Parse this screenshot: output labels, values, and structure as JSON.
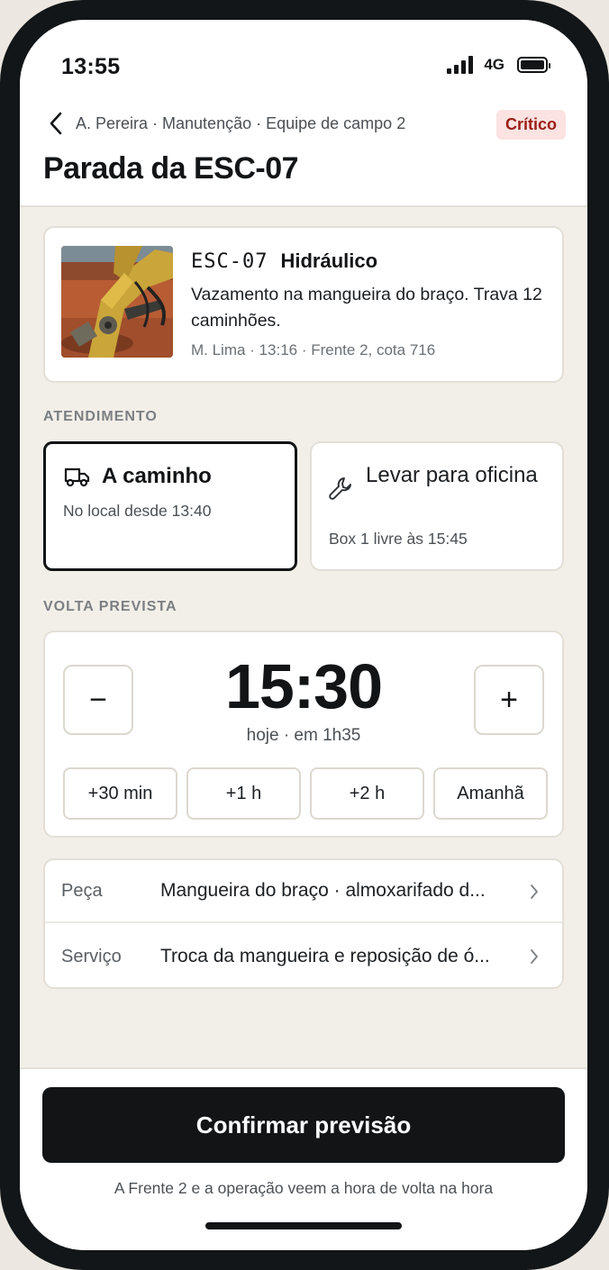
{
  "status_bar": {
    "time": "13:55",
    "network": "4G"
  },
  "header": {
    "breadcrumb": "A. Pereira · Manutenção · Equipe de campo 2",
    "badge": "Crítico",
    "title": "Parada da ESC-07"
  },
  "issue": {
    "code": "ESC-07",
    "system": "Hidráulico",
    "description": "Vazamento na mangueira do braço. Trava 12 caminhões.",
    "meta": "M. Lima · 13:16 · Frente 2, cota 716"
  },
  "attendance": {
    "section_label": "ATENDIMENTO",
    "options": [
      {
        "title": "A caminho",
        "subtitle": "No local desde 13:40",
        "icon": "truck-icon",
        "selected": true
      },
      {
        "title": "Levar para oficina",
        "subtitle": "Box 1 livre às 15:45",
        "icon": "wrench-icon",
        "selected": false
      }
    ]
  },
  "return_time": {
    "section_label": "VOLTA PREVISTA",
    "decrement": "−",
    "increment": "+",
    "time": "15:30",
    "subtitle": "hoje · em 1h35",
    "quick_options": [
      "+30 min",
      "+1 h",
      "+2 h",
      "Amanhã"
    ]
  },
  "details": [
    {
      "label": "Peça",
      "value": "Mangueira do braço · almoxarifado d..."
    },
    {
      "label": "Serviço",
      "value": "Troca da mangueira e reposição de ó..."
    }
  ],
  "footer": {
    "confirm_label": "Confirmar previsão",
    "note": "A Frente 2 e a operação veem a hora de volta na hora"
  },
  "colors": {
    "critical_badge_bg": "#fbe3e1",
    "critical_badge_text": "#9b1c16",
    "primary_button": "#121416",
    "background": "#f2efe8"
  }
}
